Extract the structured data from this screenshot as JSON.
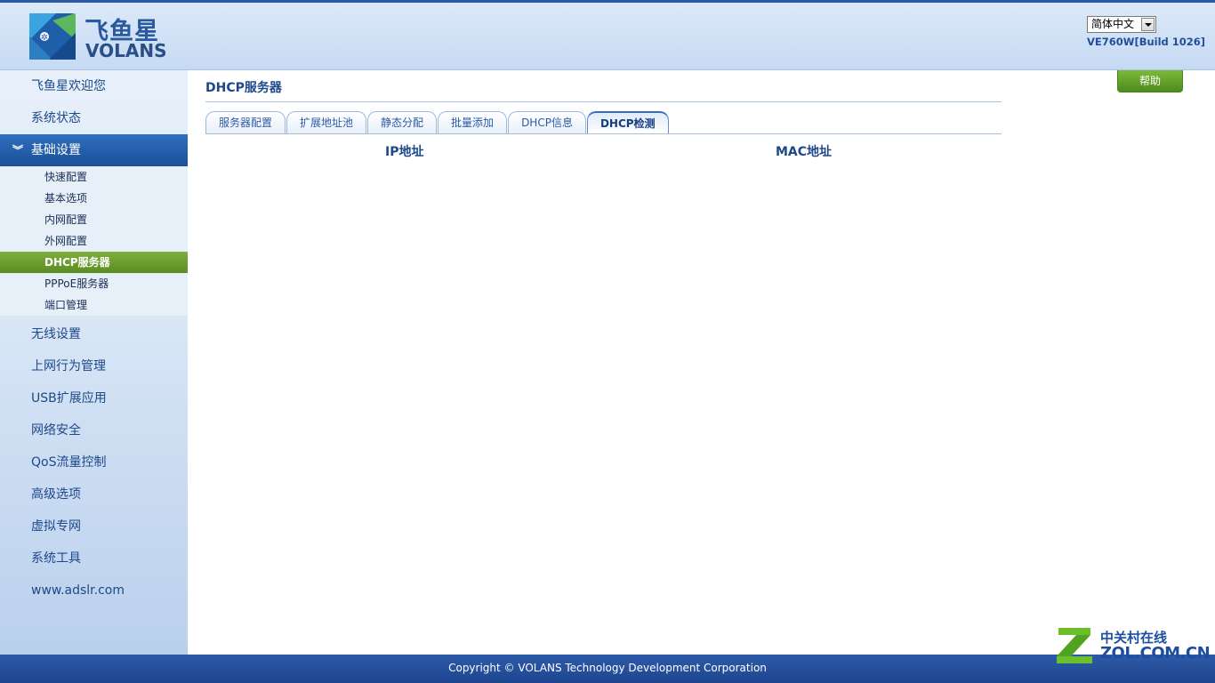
{
  "header": {
    "logo_cn": "飞鱼星",
    "logo_en": "VOLANS",
    "language": "简体中文",
    "build": "VE760W[Build 1026]"
  },
  "sidebar": {
    "welcome": "飞鱼星欢迎您",
    "status": "系统状态",
    "basic_section": "基础设置",
    "basic_items": [
      "快速配置",
      "基本选项",
      "内网配置",
      "外网配置",
      "DHCP服务器",
      "PPPoE服务器",
      "端口管理"
    ],
    "active_item": "DHCP服务器",
    "groups": [
      "无线设置",
      "上网行为管理",
      "USB扩展应用",
      "网络安全",
      "QoS流量控制",
      "高级选项",
      "虚拟专网",
      "系统工具",
      "www.adslr.com"
    ]
  },
  "main": {
    "title": "DHCP服务器",
    "help": "帮助",
    "tabs": [
      "服务器配置",
      "扩展地址池",
      "静态分配",
      "批量添加",
      "DHCP信息",
      "DHCP检测"
    ],
    "active_tab": "DHCP检测",
    "columns": [
      "IP地址",
      "MAC地址"
    ]
  },
  "footer": {
    "copyright": "Copyright © VOLANS Technology Development Corporation"
  },
  "watermark": {
    "cn": "中关村在线",
    "en": "ZOL.COM.CN"
  },
  "colors": {
    "brand_blue": "#2d5aa8",
    "active_green": "#6a9d2e"
  }
}
